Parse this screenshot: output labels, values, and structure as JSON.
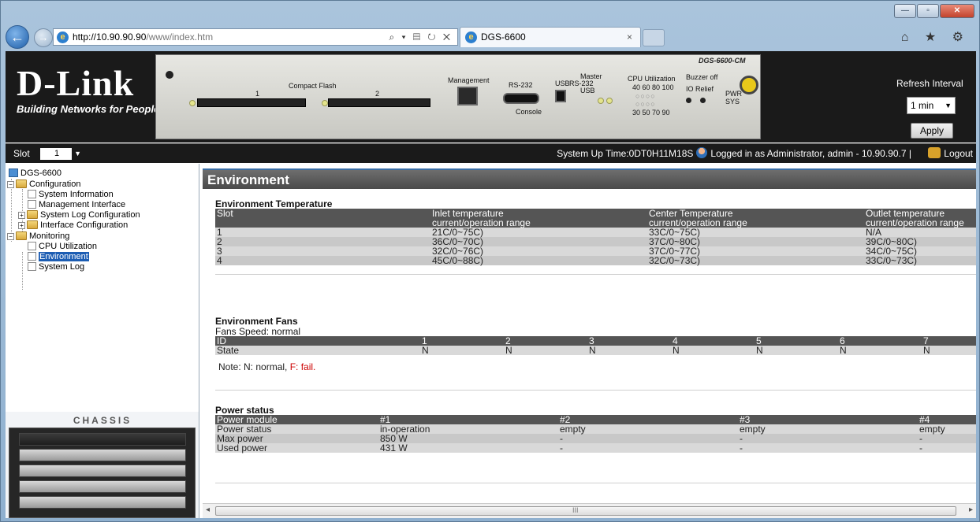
{
  "browser": {
    "url_host": "http://10.90.90.90",
    "url_path": "/www/index.htm",
    "addr_tools": "⌕ ▾ ▤ ↻ ✕",
    "tab_title": "DGS-6600",
    "tab_close": "×",
    "right_tools": "⌂ ★ ⚙",
    "win_min": "—",
    "win_max": "▫",
    "win_close": "✕",
    "back": "←",
    "forward": "→"
  },
  "header": {
    "brand": "D-Link",
    "tagline": "Building Networks for People",
    "model": "DGS-6600-CM",
    "panel_labels": {
      "compact_flash": "Compact Flash",
      "cf1": "1",
      "cf2": "2",
      "management": "Management",
      "rs232": "RS-232",
      "console": "Console",
      "usb": "USB",
      "master": "Master",
      "rs232_b": "RS-232",
      "usb_b": "USB",
      "cpu_util": "CPU Utilization",
      "cpu_top": "40 60 80 100",
      "cpu_bottom": "30 50 70 90",
      "buzzer": "Buzzer off",
      "io_relief": "IO Relief",
      "pwr": "PWR",
      "sys": "SYS"
    },
    "refresh_label": "Refresh Interval",
    "refresh_value": "1 min",
    "apply_label": "Apply"
  },
  "statusbar": {
    "slot_label": "Slot",
    "slot_value": "1",
    "uptime": "System Up Time:0DT0H11M18S",
    "logged_in": "Logged in as Administrator, admin - 10.90.90.7",
    "logout": "Logout"
  },
  "tree": {
    "root": "DGS-6600",
    "configuration": "Configuration",
    "system_information": "System Information",
    "management_interface": "Management Interface",
    "system_log_configuration": "System Log Configuration",
    "interface_configuration": "Interface Configuration",
    "monitoring": "Monitoring",
    "cpu_utilization": "CPU Utilization",
    "environment": "Environment",
    "system_log": "System Log",
    "expand_minus": "−",
    "expand_plus": "+"
  },
  "chassis": {
    "label": "CHASSIS"
  },
  "content": {
    "title": "Environment",
    "temp": {
      "section": "Environment Temperature",
      "headers": [
        "Slot",
        "Inlet temperature",
        "Center Temperature",
        "Outlet temperature"
      ],
      "subheaders": [
        "",
        "current/operation range",
        "current/operation range",
        "current/operation range"
      ],
      "rows": [
        [
          "1",
          "21C/0~75C)",
          "33C/0~75C)",
          "N/A"
        ],
        [
          "2",
          "36C/0~70C)",
          "37C/0~80C)",
          "39C/0~80C)"
        ],
        [
          "3",
          "32C/0~76C)",
          "37C/0~77C)",
          "34C/0~75C)"
        ],
        [
          "4",
          "45C/0~88C)",
          "32C/0~73C)",
          "33C/0~73C)"
        ]
      ]
    },
    "fans": {
      "section": "Environment Fans",
      "speed": "Fans Speed: normal",
      "headers": [
        "ID",
        "1",
        "2",
        "3",
        "4",
        "5",
        "6",
        "7"
      ],
      "row": [
        "State",
        "N",
        "N",
        "N",
        "N",
        "N",
        "N",
        "N"
      ],
      "note_normal": "Note: N: normal,",
      "note_fail": "F: fail."
    },
    "power": {
      "section": "Power status",
      "headers": [
        "Power module",
        "#1",
        "#2",
        "#3",
        "#4"
      ],
      "rows": [
        [
          "Power status",
          "in-operation",
          "empty",
          "empty",
          "empty"
        ],
        [
          "Max power",
          "850 W",
          "-",
          "-",
          "-"
        ],
        [
          "Used power",
          "431 W",
          "-",
          "-",
          "-"
        ]
      ]
    }
  },
  "scroll": {
    "left": "◂",
    "right": "▸",
    "grip": "III"
  }
}
